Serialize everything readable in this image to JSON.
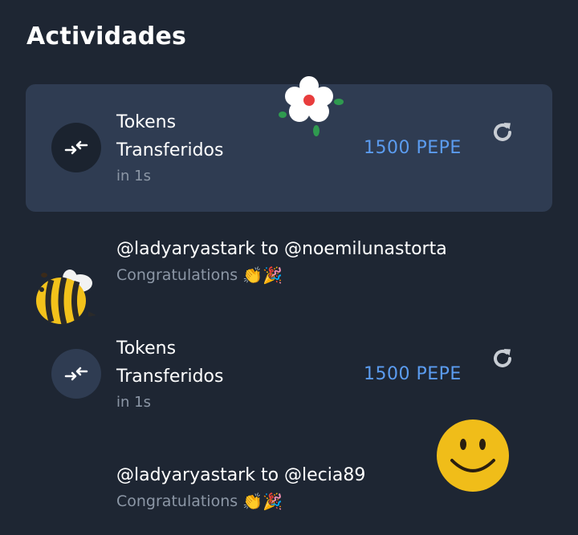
{
  "header": {
    "title": "Actividades"
  },
  "activities": [
    {
      "type": "transfer",
      "title_line1": "Tokens",
      "title_line2": "Transferidos",
      "time": "in 1s",
      "amount": "1500 PEPE",
      "highlighted": true
    },
    {
      "type": "message",
      "from_to": "@ladyaryastark to @noemilunastorta",
      "text": "Congratulations",
      "emojis": "👏🎉"
    },
    {
      "type": "transfer",
      "title_line1": "Tokens",
      "title_line2": "Transferidos",
      "time": "in 1s",
      "amount": "1500 PEPE",
      "highlighted": false
    },
    {
      "type": "message",
      "from_to": "@ladyaryastark to @lecia89",
      "text": "Congratulations",
      "emojis": "👏🎉"
    }
  ],
  "icons": {
    "transfer": "transfer-arrows-icon",
    "refresh": "refresh-icon"
  },
  "colors": {
    "background": "#1e2633",
    "card": "#2f3c52",
    "amount": "#5b9cf0",
    "muted": "#8c97a6"
  }
}
